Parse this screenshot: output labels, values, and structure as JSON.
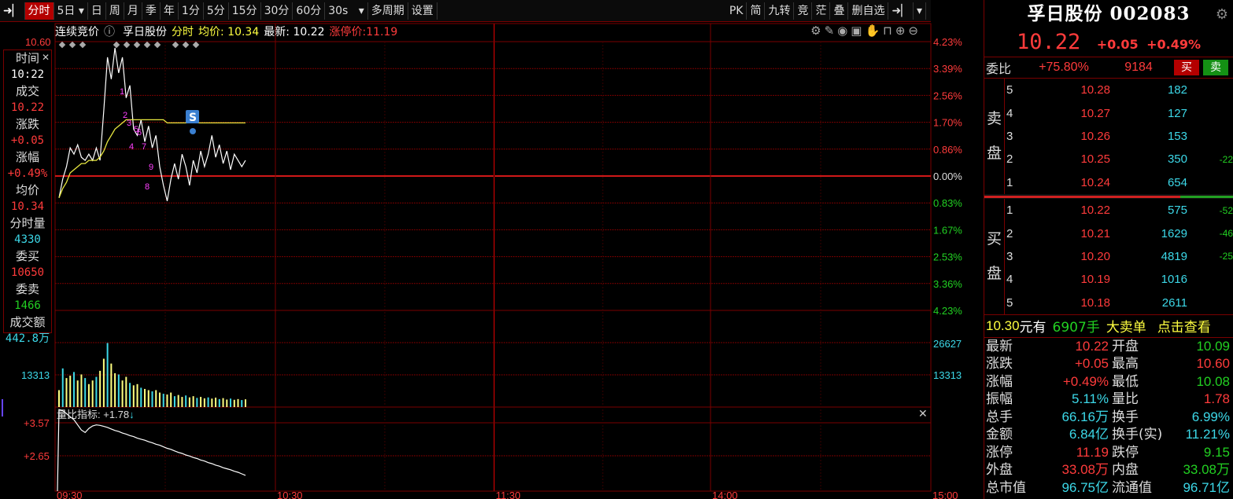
{
  "toolbar": {
    "items": [
      "分时",
      "5日",
      "日",
      "周",
      "月",
      "季",
      "年",
      "1分",
      "5分",
      "15分",
      "30分",
      "60分",
      "30s",
      "多周期",
      "设置"
    ],
    "right": [
      "PK",
      "简",
      "九转",
      "竞",
      "茫",
      "叠",
      "删自选"
    ]
  },
  "info": {
    "mode": "连续竞价",
    "name": "孚日股份",
    "tab": "分时",
    "avg_label": "均价:",
    "avg": "10.34",
    "last_label": "最新:",
    "last": "10.22",
    "limit_label": "涨停价:",
    "limit": "11.19"
  },
  "left_panel": [
    {
      "label": "时间",
      "value": "10:22",
      "color": "white"
    },
    {
      "label": "成交",
      "value": "10.22",
      "color": "red"
    },
    {
      "label": "涨跌",
      "value": "+0.05",
      "color": "red"
    },
    {
      "label": "涨幅",
      "value": "+0.49%",
      "color": "red"
    },
    {
      "label": "均价",
      "value": "10.34",
      "color": "red"
    },
    {
      "label": "分时量",
      "value": "4330",
      "color": "cyan"
    },
    {
      "label": "委买",
      "value": "10650",
      "color": "red"
    },
    {
      "label": "委卖",
      "value": "1466",
      "color": "green"
    },
    {
      "label": "成交额",
      "value": "442.8万",
      "color": "cyan"
    }
  ],
  "price_axis": {
    "top_left": "10.60",
    "right": [
      "4.23%",
      "3.39%",
      "2.56%",
      "1.70%",
      "0.86%",
      "0.00%",
      "0.83%",
      "1.67%",
      "2.53%",
      "3.36%",
      "4.23%"
    ]
  },
  "volume_axis": {
    "left": "13313",
    "right": [
      "26627",
      "13313"
    ]
  },
  "indicator": {
    "label": "量比指标:",
    "value": "+1.78",
    "arrow": "↓",
    "ticks": [
      "+3.57",
      "+2.65"
    ]
  },
  "time_axis": [
    "09:30",
    "10:30",
    "11:30",
    "14:00",
    "15:00"
  ],
  "markers": {
    "s_label": "S",
    "nums": [
      "1",
      "2",
      "3",
      "5",
      "6",
      "4",
      "7",
      "8",
      "9"
    ]
  },
  "stock": {
    "title": "孚日股份 002083",
    "price": "10.22",
    "change": "+0.05",
    "pct": "+0.49%"
  },
  "weibi": {
    "label": "委比",
    "ratio": "+75.80%",
    "diff": "9184",
    "buy": "买",
    "sell": "卖"
  },
  "sell_side_label": [
    "卖",
    "盘"
  ],
  "buy_side_label": [
    "买",
    "盘"
  ],
  "asks": [
    {
      "n": "5",
      "price": "10.28",
      "qty": "182",
      "chg": ""
    },
    {
      "n": "4",
      "price": "10.27",
      "qty": "127",
      "chg": ""
    },
    {
      "n": "3",
      "price": "10.26",
      "qty": "153",
      "chg": ""
    },
    {
      "n": "2",
      "price": "10.25",
      "qty": "350",
      "chg": "-22"
    },
    {
      "n": "1",
      "price": "10.24",
      "qty": "654",
      "chg": ""
    }
  ],
  "bids": [
    {
      "n": "1",
      "price": "10.22",
      "qty": "575",
      "chg": "-52"
    },
    {
      "n": "2",
      "price": "10.21",
      "qty": "1629",
      "chg": "-46"
    },
    {
      "n": "3",
      "price": "10.20",
      "qty": "4819",
      "chg": "-25"
    },
    {
      "n": "4",
      "price": "10.19",
      "qty": "1016",
      "chg": ""
    },
    {
      "n": "5",
      "price": "10.18",
      "qty": "2611",
      "chg": ""
    }
  ],
  "big_order": {
    "price": "10.30",
    "has": "元有",
    "qty": "6907手",
    "type": "大卖单",
    "link": "点击查看"
  },
  "stats": [
    {
      "l1": "最新",
      "v1": "10.22",
      "c1": "red",
      "l2": "开盘",
      "v2": "10.09",
      "c2": "green"
    },
    {
      "l1": "涨跌",
      "v1": "+0.05",
      "c1": "red",
      "l2": "最高",
      "v2": "10.60",
      "c2": "red"
    },
    {
      "l1": "涨幅",
      "v1": "+0.49%",
      "c1": "red",
      "l2": "最低",
      "v2": "10.08",
      "c2": "green"
    },
    {
      "l1": "振幅",
      "v1": "5.11%",
      "c1": "cyan",
      "l2": "量比",
      "v2": "1.78",
      "c2": "red"
    },
    {
      "l1": "总手",
      "v1": "66.16万",
      "c1": "cyan",
      "l2": "换手",
      "v2": "6.99%",
      "c2": "cyan"
    },
    {
      "l1": "金额",
      "v1": "6.84亿",
      "c1": "cyan",
      "l2": "换手(实)",
      "v2": "11.21%",
      "c2": "cyan"
    },
    {
      "l1": "涨停",
      "v1": "11.19",
      "c1": "red",
      "l2": "跌停",
      "v2": "9.15",
      "c2": "green"
    },
    {
      "l1": "外盘",
      "v1": "33.08万",
      "c1": "red",
      "l2": "内盘",
      "v2": "33.08万",
      "c2": "green"
    },
    {
      "l1": "总市值",
      "v1": "96.75亿",
      "c1": "cyan",
      "l2": "流通值",
      "v2": "96.71亿",
      "c2": "cyan"
    }
  ],
  "chart_data": {
    "type": "line",
    "series": [
      {
        "values": [
          10.1,
          10.16,
          10.2,
          10.26,
          10.24,
          10.27,
          10.23,
          10.22,
          10.24,
          10.22,
          10.26,
          10.22,
          10.38,
          10.55,
          10.48,
          10.58,
          10.5,
          10.55,
          10.42,
          10.46,
          10.32,
          10.3,
          10.35,
          10.28,
          10.33,
          10.26,
          10.3,
          10.2,
          10.14,
          10.09,
          10.16,
          10.21,
          10.16,
          10.24,
          10.2,
          10.14,
          10.22,
          10.18,
          10.25,
          10.2,
          10.24,
          10.3,
          10.23,
          10.27,
          10.21,
          10.25,
          10.19,
          10.24,
          10.22,
          10.2,
          10.22
        ]
      },
      {
        "values": [
          10.1,
          10.13,
          10.15,
          10.18,
          10.19,
          10.2,
          10.21,
          10.21,
          10.22,
          10.22,
          10.22,
          10.23,
          10.25,
          10.28,
          10.3,
          10.32,
          10.33,
          10.34,
          10.35,
          10.35,
          10.35,
          10.35,
          10.35,
          10.35,
          10.35,
          10.35,
          10.35,
          10.35,
          10.35,
          10.34,
          10.34,
          10.34,
          10.34,
          10.34,
          10.34,
          10.34,
          10.34,
          10.34,
          10.34,
          10.34,
          10.34,
          10.34,
          10.34,
          10.34,
          10.34,
          10.34,
          10.34,
          10.34,
          10.34,
          10.34,
          10.34
        ]
      }
    ],
    "volume": [
      7000,
      16000,
      12000,
      13000,
      14500,
      11000,
      13500,
      12000,
      9500,
      11000,
      12500,
      15000,
      20000,
      26500,
      18000,
      14000,
      13500,
      11000,
      12500,
      10000,
      9000,
      9500,
      8000,
      7500,
      7000,
      6500,
      7000,
      6000,
      5500,
      5200,
      6000,
      4500,
      5000,
      4200,
      4800,
      4000,
      4500,
      3800,
      4200,
      3600,
      4000,
      3500,
      3900,
      3300,
      3700,
      3100,
      3500,
      3000,
      3300,
      2900,
      3200
    ],
    "volume_ratio": [
      3.7,
      3.68,
      3.62,
      3.56,
      3.5,
      3.4,
      3.3,
      3.25,
      3.33,
      3.38,
      3.4,
      3.39,
      3.37,
      3.35,
      3.32,
      3.29,
      3.27,
      3.24,
      3.22,
      3.19,
      3.17,
      3.14,
      3.12,
      3.1,
      3.07,
      3.05,
      3.02,
      3.0,
      2.97,
      2.94,
      2.92,
      2.89,
      2.86,
      2.84,
      2.81,
      2.79,
      2.76,
      2.74,
      2.71,
      2.69,
      2.66,
      2.64,
      2.61,
      2.59,
      2.56,
      2.54,
      2.52,
      2.49,
      2.47,
      2.44,
      2.41
    ],
    "prev_close": 10.17,
    "price_range": [
      9.74,
      10.6
    ],
    "volume_max": 40000,
    "volume_ratio_range": [
      2.1,
      3.75
    ],
    "xticks": [
      "09:30",
      "10:30",
      "11:30",
      "14:00",
      "15:00"
    ]
  }
}
